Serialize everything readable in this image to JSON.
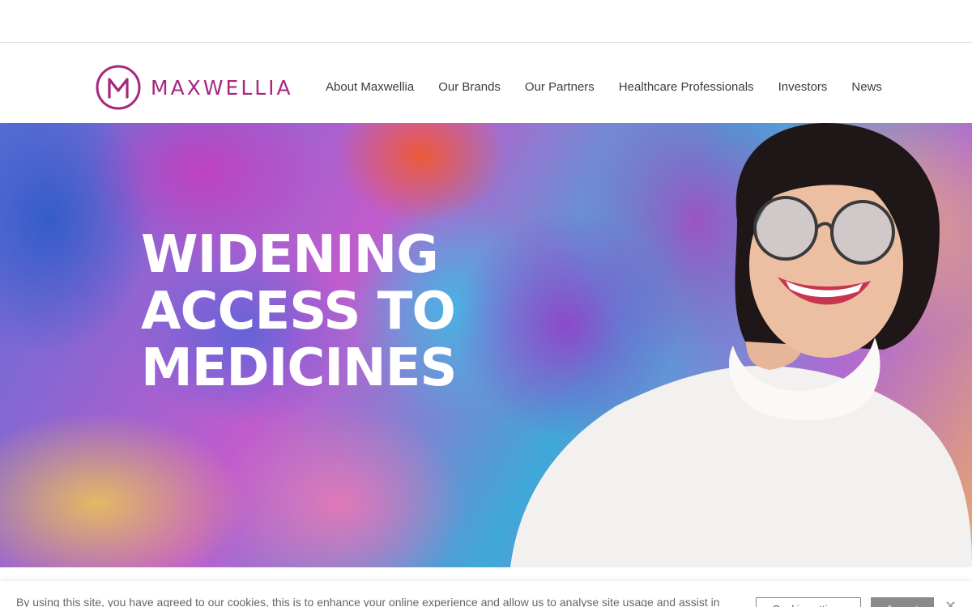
{
  "header": {
    "logo_text": "MAXWELLIA",
    "brand_color": "#a7277d"
  },
  "nav": {
    "items": [
      {
        "label": "About Maxwellia"
      },
      {
        "label": "Our Brands"
      },
      {
        "label": "Our Partners"
      },
      {
        "label": "Healthcare Professionals"
      },
      {
        "label": "Investors"
      },
      {
        "label": "News"
      }
    ]
  },
  "hero": {
    "title_lines": [
      "WIDENING",
      "ACCESS TO",
      "MEDICINES"
    ]
  },
  "cookie_bar": {
    "text": "By using this site, you have agreed to our cookies, this is to enhance your online experience and allow us to analyse site usage and assist in",
    "settings_label": "Cookie settings",
    "accept_label": "Accept",
    "close_icon": "close-icon"
  }
}
